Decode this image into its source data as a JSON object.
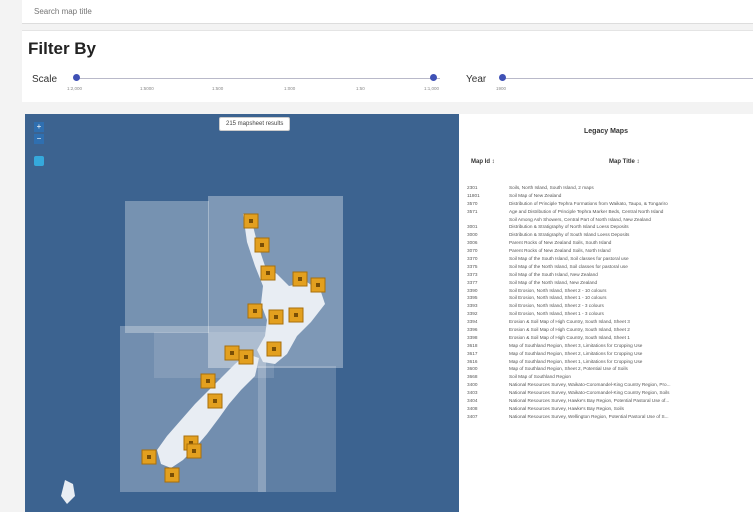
{
  "search": {
    "placeholder": "Search map title"
  },
  "filter": {
    "title": "Filter By",
    "scale_label": "Scale",
    "year_label": "Year",
    "scale_ticks": [
      "1:2,000",
      "1:5000",
      "1:500",
      "1:000",
      "1:50",
      "1:1,000"
    ],
    "year_ticks": [
      "1900"
    ]
  },
  "map": {
    "results_badge": "215 mapsheet results",
    "zoom_in": "+",
    "zoom_out": "−",
    "marker_count": 17
  },
  "panel": {
    "title": "Legacy Maps",
    "col_id": "Map Id ↕",
    "col_title": "Map Title ↕",
    "rows": [
      {
        "id": "2301",
        "title": "Soils, North Island, South Island, 2 maps"
      },
      {
        "id": "11801",
        "title": "Soil Map of New Zealand"
      },
      {
        "id": "3570",
        "title": "Distribution of Principle Tephra Formations from Waikato, Taupo, & Tongariro"
      },
      {
        "id": "3571",
        "title": "Age and Distribution of Principle Tephra Marker Beds, Central North Island"
      },
      {
        "id": "",
        "title": "Soil Among Ash Showers, Central Part of North Island, New Zealand"
      },
      {
        "id": "3001",
        "title": "Distribution & Stratigraphy of North Island Loess Deposits"
      },
      {
        "id": "3000",
        "title": "Distribution & Stratigraphy of South Island Loess Deposits"
      },
      {
        "id": "3006",
        "title": "Parent Rocks of New Zealand Soils, South Island"
      },
      {
        "id": "3070",
        "title": "Parent Rocks of New Zealand Soils, North Island"
      },
      {
        "id": "3370",
        "title": "Soil Map of the South Island, Soil classes for pastoral use"
      },
      {
        "id": "3375",
        "title": "Soil Map of the North Island, Soil classes for pastoral use"
      },
      {
        "id": "3373",
        "title": "Soil Map of the South Island, New Zealand"
      },
      {
        "id": "3377",
        "title": "Soil Map of the North Island, New Zealand"
      },
      {
        "id": "3390",
        "title": "Soil Erosion, North Island, Sheet 2 - 10 colours"
      },
      {
        "id": "3395",
        "title": "Soil Erosion, North Island, Sheet 1 - 10 colours"
      },
      {
        "id": "3393",
        "title": "Soil Erosion, North Island, Sheet 2 - 3 colours"
      },
      {
        "id": "3392",
        "title": "Soil Erosion, North Island, Sheet 1 - 3 colours"
      },
      {
        "id": "3394",
        "title": "Erosion & Soil Map of High Country, South Island, Sheet 3"
      },
      {
        "id": "3396",
        "title": "Erosion & Soil Map of High Country, South Island, Sheet 2"
      },
      {
        "id": "3398",
        "title": "Erosion & Soil Map of High Country, South Island, Sheet 1"
      },
      {
        "id": "3618",
        "title": "Map of Southland Region, Sheet 3, Limitations for Cropping Use"
      },
      {
        "id": "3617",
        "title": "Map of Southland Region, Sheet 2, Limitations for Cropping Use"
      },
      {
        "id": "3616",
        "title": "Map of Southland Region, Sheet 1, Limitations for Cropping Use"
      },
      {
        "id": "3600",
        "title": "Map of Southland Region, Sheet 2, Potential Use of Soils"
      },
      {
        "id": "3668",
        "title": "Soil Map of Southland Region"
      },
      {
        "id": "3400",
        "title": "National Resources Survey, Waikato-Coromandel-King Country Region, Pro..."
      },
      {
        "id": "3403",
        "title": "National Resources Survey, Waikato-Coromandel-King Country Region, Soils"
      },
      {
        "id": "3404",
        "title": "National Resources Survey, Hawke's Bay Region, Potential Pastoral Use of..."
      },
      {
        "id": "3408",
        "title": "National Resources Survey, Hawke's Bay Region, Soils"
      },
      {
        "id": "3407",
        "title": "National Resources Survey, Wellington Region, Potential Pastoral Use of S..."
      }
    ]
  }
}
